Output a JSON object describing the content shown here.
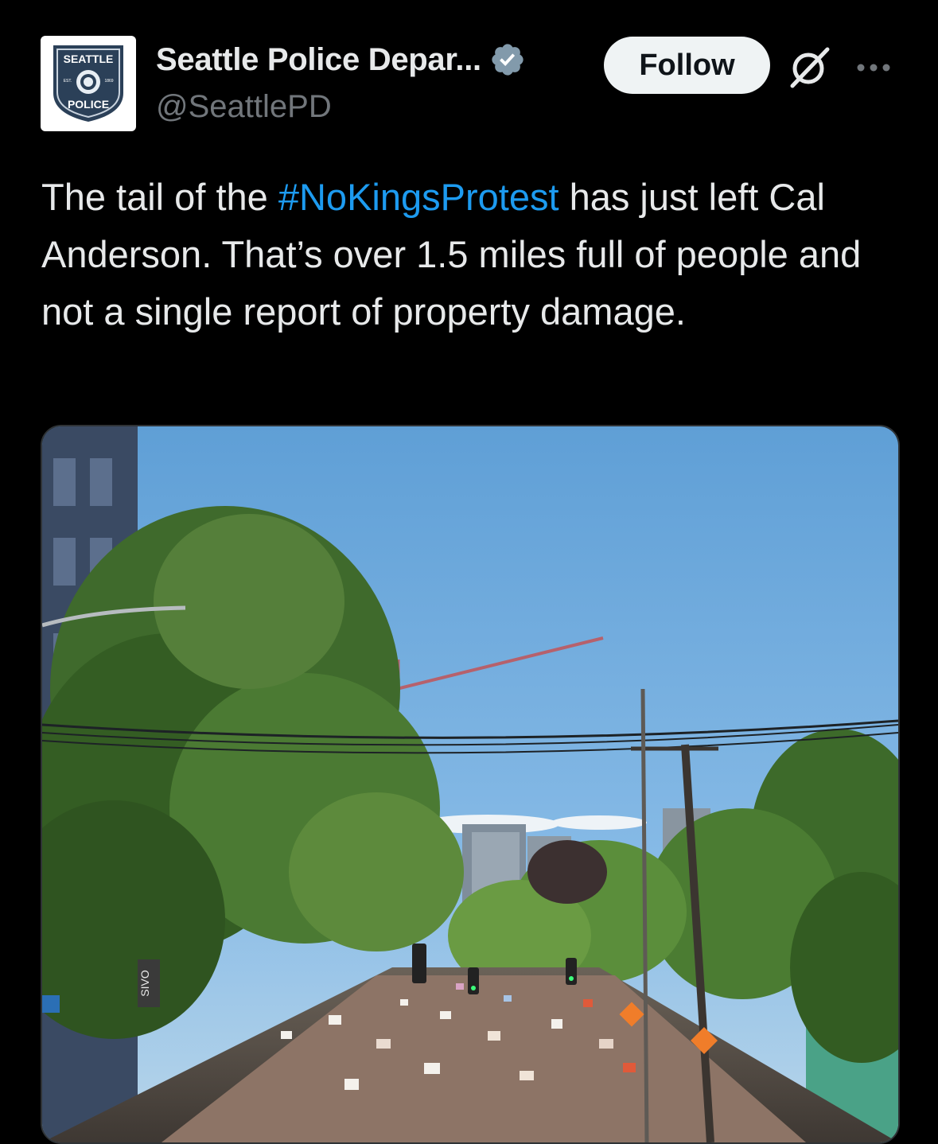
{
  "author": {
    "display_name": "Seattle Police Depar...",
    "handle": "@SeattlePD",
    "verified": true,
    "avatar_badge_text": [
      "SEATTLE",
      "POLICE"
    ],
    "avatar_seal_text": [
      "EST.",
      "1869"
    ]
  },
  "actions": {
    "follow_label": "Follow",
    "grok_icon": "grok-icon",
    "more_icon": "more-icon"
  },
  "tweet": {
    "text_before": "The tail of the ",
    "hashtag": "#NoKingsProtest",
    "text_after": " has just left Cal Anderson. That’s over 1.5 miles full of people and not a single report of property damage."
  },
  "media": {
    "type": "photo",
    "sign_text": "SIVO"
  },
  "colors": {
    "background": "#000000",
    "text": "#e7e9ea",
    "secondary_text": "#71767b",
    "link": "#1d9bf0",
    "verified": "#829aab",
    "follow_bg": "#eff3f4"
  }
}
